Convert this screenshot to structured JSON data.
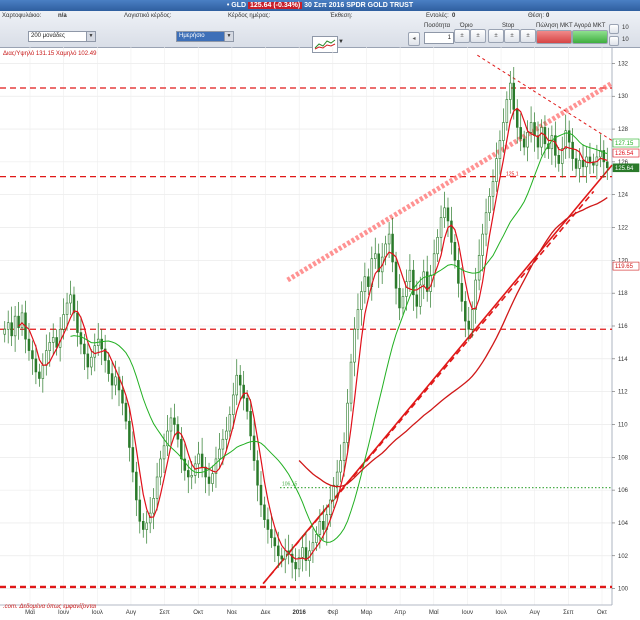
{
  "window": {
    "title_prefix": "• GLD",
    "price_badge": "125.64 (-0.34%)",
    "title_suffix": "30 Σεπ 2016  SPDR GOLD TRUST"
  },
  "toolbar": {
    "portfolio_label": "Χαρτοφυλάκιο:",
    "portfolio_value": "n/a",
    "account_gain_label": "Λογιστικό κέρδος:",
    "day_gain_label": "Κέρδος ημέρας:",
    "exposure_label": "Έκθεση:",
    "orders_label": "Εντολές:",
    "orders_value": "0",
    "position_label": "Θέση:",
    "position_value": "0",
    "range_select": "200 μονάδες",
    "interval_select": "Ημερήσιο",
    "quantity_label": "Ποσότητα",
    "quantity_value": "1",
    "limit_label": "Όριο",
    "stop_label": "Stop",
    "sell_mkt_label": "Πώληση ΜΚΤ",
    "buy_mkt_label": "Αγορά ΜΚΤ",
    "side_value_1": "10",
    "side_value_2": "10"
  },
  "info_line": "Διας/Υψηλό 131.15 Χαμηλό 102.49",
  "footer_note": ".com. Δεδομένα όπως εμφανίζονται",
  "price_tags": {
    "tag_1": "127.15",
    "tag_2": "126.54",
    "tag_3": "125.64",
    "tag_4": "119.65",
    "level_125": "125.1",
    "level_106": "106.15"
  },
  "colors": {
    "background": "#ffffff",
    "candle": "#2a7a2a",
    "ma_short": "#e0101a",
    "ma_mid": "#22b022",
    "ma_long": "#d01818",
    "trendline": "#e01818",
    "channel": "#ff6f6f"
  },
  "chart_data": {
    "type": "line",
    "title": "",
    "xlabel": "",
    "ylabel": "",
    "ylim": [
      99,
      133
    ],
    "y_ticks": [
      100,
      102,
      104,
      106,
      108,
      110,
      112,
      114,
      116,
      118,
      120,
      122,
      124,
      126,
      128,
      130,
      132
    ],
    "y_tick_labels": [
      "100",
      "102",
      "104",
      "106",
      "108",
      "110",
      "112",
      "114",
      "116",
      "118",
      "120",
      "122",
      "124",
      "126",
      "128",
      "130",
      "132"
    ],
    "x_labels": [
      "Μαϊ",
      "Ιουν",
      "Ιουλ",
      "Αυγ",
      "Σεπ",
      "Οκτ",
      "Νοε",
      "Δεκ",
      "2016",
      "Φεβ",
      "Μαρ",
      "Απρ",
      "Μαϊ",
      "Ιουν",
      "Ιουλ",
      "Αυγ",
      "Σεπ",
      "Οκτ"
    ],
    "close": [
      115.8,
      116.2,
      115.4,
      116.6,
      115.9,
      116.8,
      115.2,
      114.5,
      114.0,
      113.2,
      112.8,
      113.6,
      114.5,
      115.0,
      115.3,
      114.7,
      115.8,
      116.7,
      117.4,
      117.9,
      116.8,
      115.6,
      114.9,
      114.3,
      113.5,
      114.1,
      114.8,
      115.2,
      114.6,
      113.9,
      113.1,
      112.4,
      112.9,
      112.1,
      111.3,
      110.2,
      108.6,
      107.1,
      105.4,
      104.1,
      103.6,
      104.0,
      104.6,
      105.5,
      106.8,
      107.9,
      108.7,
      109.6,
      110.4,
      110.0,
      109.1,
      107.9,
      107.2,
      106.8,
      106.9,
      107.6,
      108.2,
      107.4,
      106.8,
      106.4,
      107.0,
      107.9,
      108.5,
      109.1,
      109.6,
      110.6,
      111.8,
      113.0,
      112.4,
      111.6,
      110.8,
      109.3,
      107.8,
      106.3,
      105.1,
      104.2,
      103.6,
      103.1,
      102.6,
      102.0,
      101.8,
      102.3,
      102.1,
      101.6,
      101.2,
      101.9,
      102.5,
      101.7,
      102.3,
      102.8,
      103.3,
      104.1,
      103.6,
      104.5,
      105.4,
      106.3,
      107.1,
      107.8,
      108.9,
      111.3,
      113.8,
      115.8,
      117.0,
      118.1,
      119.0,
      118.4,
      120.1,
      120.4,
      119.3,
      120.2,
      121.0,
      121.6,
      119.9,
      118.3,
      117.1,
      117.8,
      118.7,
      119.4,
      117.9,
      117.2,
      118.5,
      119.3,
      118.1,
      119.1,
      120.4,
      121.4,
      122.6,
      123.2,
      122.4,
      121.1,
      120.0,
      118.6,
      117.5,
      116.3,
      115.8,
      117.0,
      118.8,
      120.3,
      121.6,
      122.9,
      123.9,
      124.8,
      126.2,
      127.3,
      128.4,
      129.8,
      130.8,
      129.2,
      128.1,
      127.4,
      126.9,
      127.8,
      128.4,
      127.6,
      126.9,
      128.1,
      127.1,
      126.8,
      127.6,
      126.4,
      125.9,
      126.8,
      127.9,
      127.2,
      126.2,
      125.6,
      126.1,
      125.7,
      126.3,
      126.0,
      125.8,
      126.3,
      126.7,
      126.0,
      125.64
    ],
    "high_low": {
      "high": 131.15,
      "low": 102.49
    },
    "horizontal_levels": [
      130.5,
      125.1,
      115.8,
      106.15,
      100.1
    ],
    "trendlines": [
      {
        "name": "support",
        "from": [
          0.43,
          100.3
        ],
        "to": [
          1.0,
          125.8
        ],
        "style": "solid"
      },
      {
        "name": "support-dashed",
        "from": [
          0.43,
          100.3
        ],
        "to": [
          0.97,
          124.2
        ],
        "style": "dashed"
      },
      {
        "name": "channel-upper",
        "from": [
          0.47,
          118.8
        ],
        "to": [
          1.0,
          130.8
        ],
        "style": "dashed-thick"
      },
      {
        "name": "resistance-down",
        "from": [
          0.78,
          132.5
        ],
        "to": [
          1.0,
          127.3
        ],
        "style": "dashed"
      }
    ],
    "grid": true,
    "legend": "none"
  }
}
